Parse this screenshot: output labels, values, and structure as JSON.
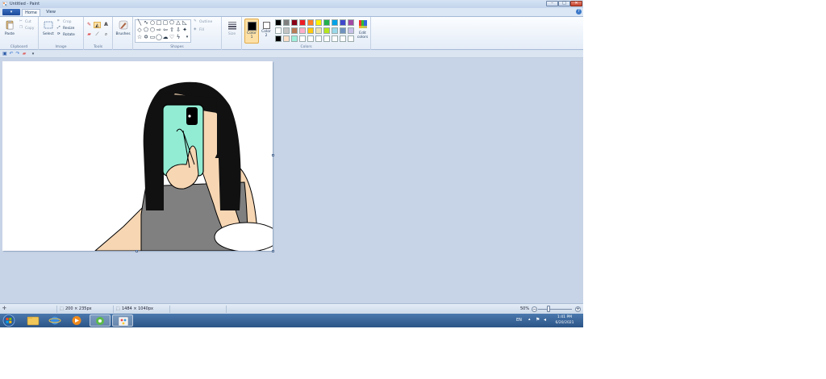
{
  "window": {
    "title": "Untitled - Paint",
    "minimize_label": "–",
    "maximize_label": "□",
    "close_label": "✕"
  },
  "menu": {
    "file_tab": "▾",
    "tabs": [
      {
        "label": "Home"
      },
      {
        "label": "View"
      }
    ],
    "help_label": "?"
  },
  "ribbon": {
    "clipboard": {
      "paste_label": "Paste",
      "cut_label": "Cut",
      "copy_label": "Copy",
      "group_label": "Clipboard"
    },
    "image": {
      "select_label": "Select",
      "crop_label": "Crop",
      "resize_label": "Resize",
      "rotate_label": "Rotate",
      "group_label": "Image"
    },
    "tools": {
      "group_label": "Tools"
    },
    "brushes": {
      "label": "Brushes"
    },
    "shapes": {
      "outline_label": "Outline",
      "fill_label": "Fill",
      "group_label": "Shapes"
    },
    "size": {
      "label": "Size"
    },
    "colors": {
      "color1_label": "Color 1",
      "color2_label": "Color 2",
      "edit_colors_label": "Edit colors",
      "group_label": "Colors",
      "color1": "#000000",
      "color2": "#ffffff",
      "palette_row1": [
        "#000000",
        "#7f7f7f",
        "#880015",
        "#ed1c24",
        "#ff7f27",
        "#fff200",
        "#22b14c",
        "#00a2e8",
        "#3f48cc",
        "#a349a4"
      ],
      "palette_row2": [
        "#ffffff",
        "#c3c3c3",
        "#b97a57",
        "#ffaec9",
        "#ffc90e",
        "#efe4b0",
        "#b5e61d",
        "#99d9ea",
        "#7092be",
        "#c8bfe7"
      ],
      "palette_row3": [
        "#000000",
        "#fde0c8",
        "#9ff0dc",
        "#ffffff",
        "#ffffff",
        "#ffffff",
        "#ffffff",
        "#ffffff",
        "#ffffff",
        "#ffffff"
      ]
    }
  },
  "statusbar": {
    "selection_size": "200 × 235px",
    "image_size": "1484 × 1040px",
    "zoom": "50%"
  },
  "taskbar": {
    "time": "1:41 PM",
    "date": "6/20/2021",
    "language": "EN"
  }
}
